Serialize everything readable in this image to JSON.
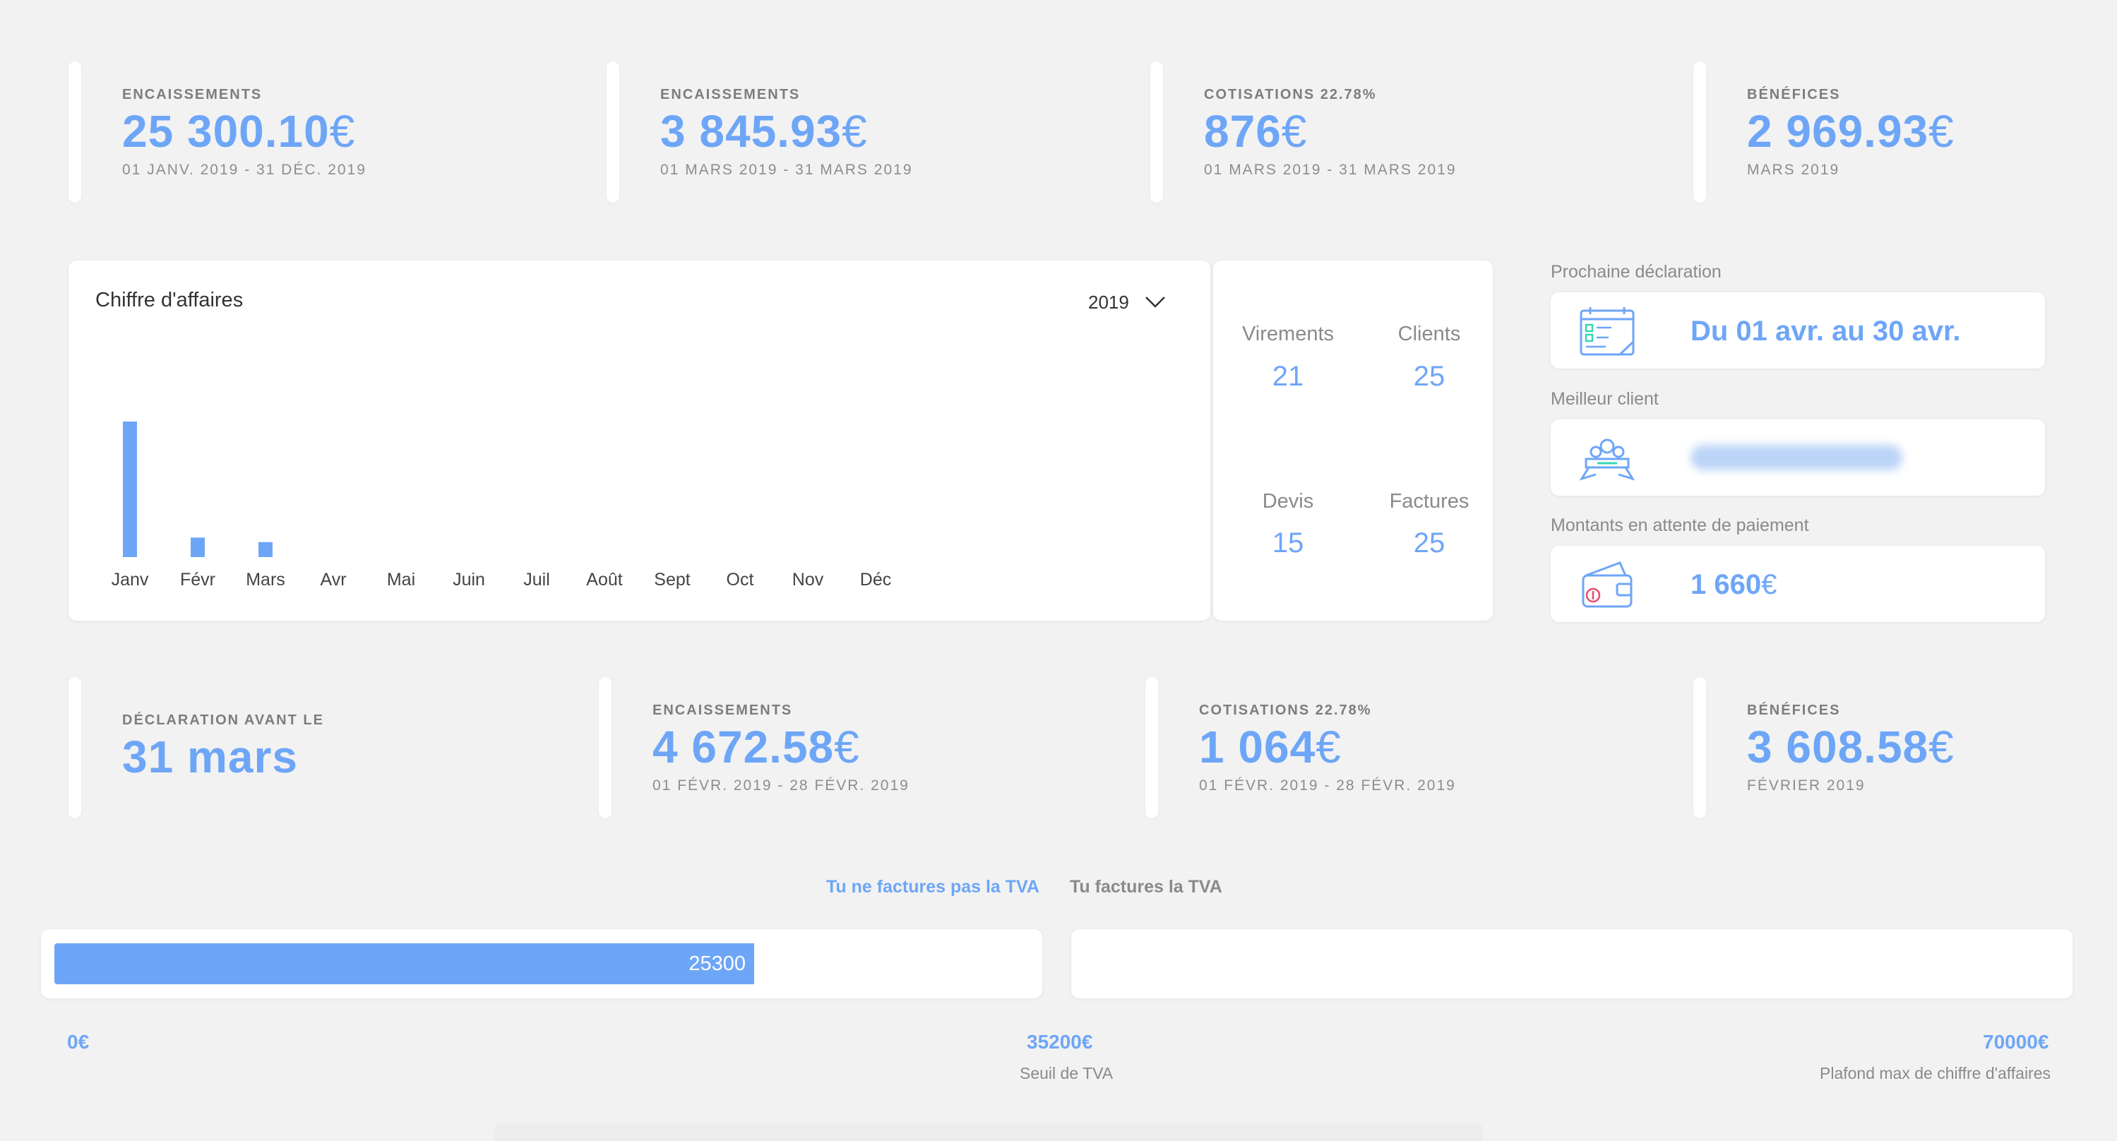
{
  "top_stats": [
    {
      "label": "ENCAISSEMENTS",
      "value": "25 300.10",
      "currency": "€",
      "period": "01 JANV. 2019 - 31 DÉC. 2019"
    },
    {
      "label": "ENCAISSEMENTS",
      "value": "3 845.93",
      "currency": "€",
      "period": "01 MARS 2019 - 31 MARS 2019"
    },
    {
      "label": "COTISATIONS 22.78%",
      "value": "876",
      "currency": "€",
      "period": "01 MARS 2019 - 31 MARS 2019"
    },
    {
      "label": "BÉNÉFICES",
      "value": "2 969.93",
      "currency": "€",
      "period": "MARS 2019"
    }
  ],
  "chart": {
    "title": "Chiffre d'affaires",
    "year": "2019",
    "icons": {
      "dropdown": "chevron-down-icon"
    }
  },
  "chart_data": {
    "type": "bar",
    "title": "Chiffre d'affaires",
    "categories": [
      "Janv",
      "Févr",
      "Mars",
      "Avr",
      "Mai",
      "Juin",
      "Juil",
      "Août",
      "Sept",
      "Oct",
      "Nov",
      "Déc"
    ],
    "values": [
      25300,
      3640,
      2800,
      0,
      0,
      0,
      0,
      0,
      0,
      0,
      0,
      0
    ],
    "color": "#6ea6f7",
    "grid": false
  },
  "counts": [
    {
      "label": "Virements",
      "value": "21"
    },
    {
      "label": "Clients",
      "value": "25"
    },
    {
      "label": "Devis",
      "value": "15"
    },
    {
      "label": "Factures",
      "value": "25"
    }
  ],
  "side": {
    "next_declaration": {
      "label": "Prochaine déclaration",
      "value": "Du 01 avr. au 30 avr.",
      "icon": "calendar-icon"
    },
    "best_client": {
      "label": "Meilleur client",
      "icon": "trophy-podium-icon"
    },
    "pending": {
      "label": "Montants en attente de paiement",
      "value": "1 660",
      "currency": "€",
      "icon": "wallet-icon"
    }
  },
  "bottom_stats": {
    "declaration": {
      "label": "DÉCLARATION AVANT LE",
      "value": "31 mars"
    },
    "cards": [
      {
        "label": "ENCAISSEMENTS",
        "value": "4 672.58",
        "currency": "€",
        "period": "01 FÉVR. 2019 - 28 FÉVR. 2019"
      },
      {
        "label": "COTISATIONS 22.78%",
        "value": "1 064",
        "currency": "€",
        "period": "01 FÉVR. 2019 - 28 FÉVR. 2019"
      },
      {
        "label": "BÉNÉFICES",
        "value": "3 608.58",
        "currency": "€",
        "period": "FÉVRIER 2019"
      }
    ]
  },
  "tva": {
    "tab_active": "Tu ne factures pas la TVA",
    "tab_inactive": "Tu factures la TVA",
    "progress_value": "25300",
    "progress_amount": 25300,
    "threshold_amount": 35200,
    "scale_start": "0€",
    "threshold": "35200€",
    "threshold_caption": "Seuil de TVA",
    "max": "70000€",
    "max_caption": "Plafond max de chiffre d'affaires"
  },
  "colors": {
    "accent": "#6ea6f7",
    "background": "#f2f2f2",
    "muted": "#8a8a8a"
  }
}
